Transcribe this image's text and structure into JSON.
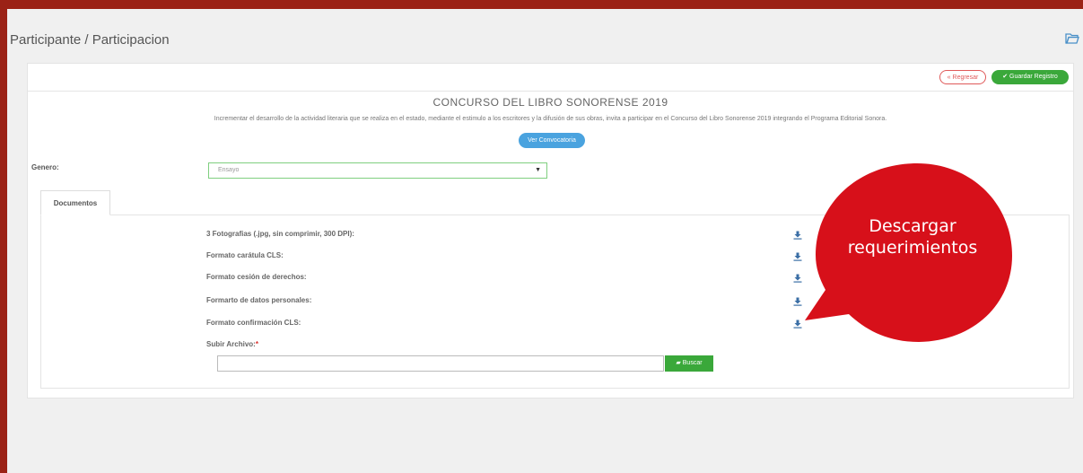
{
  "breadcrumb": "Participante / Participacion",
  "actions": {
    "back_label": "« Regresar",
    "save_label": "✔ Guardar Registro"
  },
  "contest": {
    "title": "CONCURSO DEL LIBRO SONORENSE 2019",
    "description": "Incrementar el desarrollo de la actividad literaria que se realiza en el estado, mediante el estimulo a los escritores y la difusión de sus obras, invita a participar en el Concurso del Libro Sonorense 2019 integrando el Programa Editorial Sonora.",
    "convocatoria_label": "Ver Convocatoria"
  },
  "form": {
    "genero_label": "Genero:",
    "genero_value": "Ensayo"
  },
  "tabs": {
    "documents_label": "Documentos"
  },
  "documents": [
    "3 Fotografias (.jpg, sin comprimir, 300 DPI):",
    "Formato carátula CLS:",
    "Formato cesión de derechos:",
    "Formarto de datos personales:",
    "Formato confirmación CLS:"
  ],
  "upload": {
    "label": "Subir Archivo:",
    "required_mark": "*",
    "browse_label": "Buscar"
  },
  "callout": {
    "line1": "Descargar",
    "line2": "requerimientos",
    "color": "#d7101a"
  },
  "colors": {
    "frame": "#9b2216",
    "success": "#3aa83a",
    "info": "#4aa3df",
    "icon_blue": "#3a6ea5"
  }
}
